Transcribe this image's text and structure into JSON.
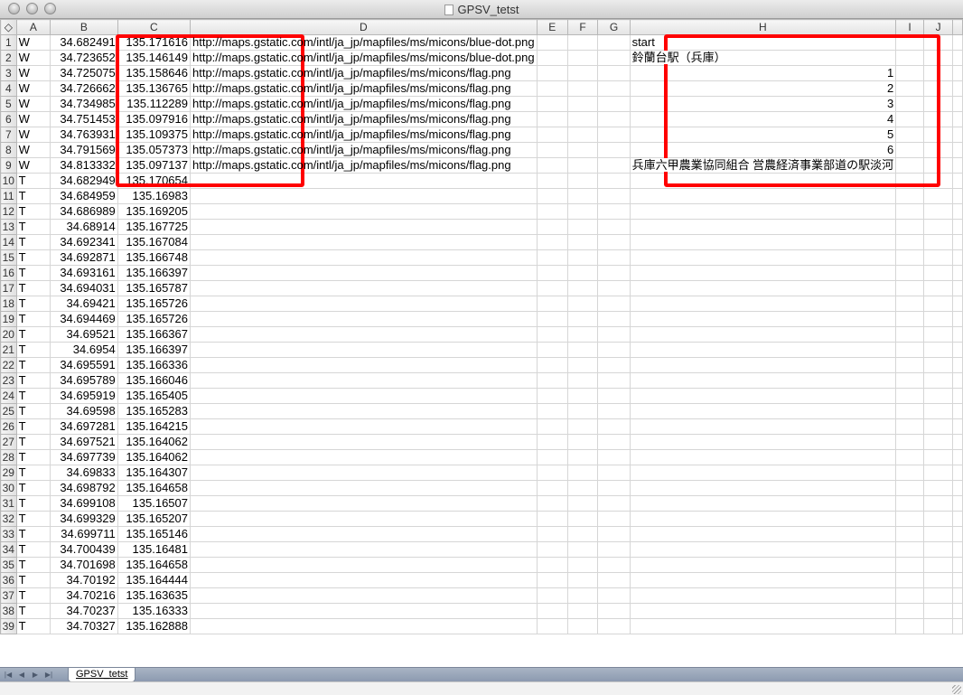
{
  "window": {
    "title": "GPSV_tetst"
  },
  "columns": [
    "A",
    "B",
    "C",
    "D",
    "E",
    "F",
    "G",
    "H",
    "I",
    "J"
  ],
  "corner_icon": "select-all-icon",
  "rows": [
    {
      "n": "1",
      "a": "W",
      "b": "34.682491",
      "c": "135.171616",
      "d": "http://maps.gstatic.com/intl/ja_jp/mapfiles/ms/micons/blue-dot.png",
      "h": "start"
    },
    {
      "n": "2",
      "a": "W",
      "b": "34.723652",
      "c": "135.146149",
      "d": "http://maps.gstatic.com/intl/ja_jp/mapfiles/ms/micons/blue-dot.png",
      "h": "鈴蘭台駅（兵庫）"
    },
    {
      "n": "3",
      "a": "W",
      "b": "34.725075",
      "c": "135.158646",
      "d": "http://maps.gstatic.com/intl/ja_jp/mapfiles/ms/micons/flag.png",
      "h": "1"
    },
    {
      "n": "4",
      "a": "W",
      "b": "34.726662",
      "c": "135.136765",
      "d": "http://maps.gstatic.com/intl/ja_jp/mapfiles/ms/micons/flag.png",
      "h": "2"
    },
    {
      "n": "5",
      "a": "W",
      "b": "34.734985",
      "c": "135.112289",
      "d": "http://maps.gstatic.com/intl/ja_jp/mapfiles/ms/micons/flag.png",
      "h": "3"
    },
    {
      "n": "6",
      "a": "W",
      "b": "34.751453",
      "c": "135.097916",
      "d": "http://maps.gstatic.com/intl/ja_jp/mapfiles/ms/micons/flag.png",
      "h": "4"
    },
    {
      "n": "7",
      "a": "W",
      "b": "34.763931",
      "c": "135.109375",
      "d": "http://maps.gstatic.com/intl/ja_jp/mapfiles/ms/micons/flag.png",
      "h": "5"
    },
    {
      "n": "8",
      "a": "W",
      "b": "34.791569",
      "c": "135.057373",
      "d": "http://maps.gstatic.com/intl/ja_jp/mapfiles/ms/micons/flag.png",
      "h": "6"
    },
    {
      "n": "9",
      "a": "W",
      "b": "34.813332",
      "c": "135.097137",
      "d": "http://maps.gstatic.com/intl/ja_jp/mapfiles/ms/micons/flag.png",
      "h": "兵庫六甲農業協同組合 営農経済事業部道の駅淡河"
    },
    {
      "n": "10",
      "a": "T",
      "b": "34.682949",
      "c": "135.170654"
    },
    {
      "n": "11",
      "a": "T",
      "b": "34.684959",
      "c": "135.16983"
    },
    {
      "n": "12",
      "a": "T",
      "b": "34.686989",
      "c": "135.169205"
    },
    {
      "n": "13",
      "a": "T",
      "b": "34.68914",
      "c": "135.167725"
    },
    {
      "n": "14",
      "a": "T",
      "b": "34.692341",
      "c": "135.167084"
    },
    {
      "n": "15",
      "a": "T",
      "b": "34.692871",
      "c": "135.166748"
    },
    {
      "n": "16",
      "a": "T",
      "b": "34.693161",
      "c": "135.166397"
    },
    {
      "n": "17",
      "a": "T",
      "b": "34.694031",
      "c": "135.165787"
    },
    {
      "n": "18",
      "a": "T",
      "b": "34.69421",
      "c": "135.165726"
    },
    {
      "n": "19",
      "a": "T",
      "b": "34.694469",
      "c": "135.165726"
    },
    {
      "n": "20",
      "a": "T",
      "b": "34.69521",
      "c": "135.166367"
    },
    {
      "n": "21",
      "a": "T",
      "b": "34.6954",
      "c": "135.166397"
    },
    {
      "n": "22",
      "a": "T",
      "b": "34.695591",
      "c": "135.166336"
    },
    {
      "n": "23",
      "a": "T",
      "b": "34.695789",
      "c": "135.166046"
    },
    {
      "n": "24",
      "a": "T",
      "b": "34.695919",
      "c": "135.165405"
    },
    {
      "n": "25",
      "a": "T",
      "b": "34.69598",
      "c": "135.165283"
    },
    {
      "n": "26",
      "a": "T",
      "b": "34.697281",
      "c": "135.164215"
    },
    {
      "n": "27",
      "a": "T",
      "b": "34.697521",
      "c": "135.164062"
    },
    {
      "n": "28",
      "a": "T",
      "b": "34.697739",
      "c": "135.164062"
    },
    {
      "n": "29",
      "a": "T",
      "b": "34.69833",
      "c": "135.164307"
    },
    {
      "n": "30",
      "a": "T",
      "b": "34.698792",
      "c": "135.164658"
    },
    {
      "n": "31",
      "a": "T",
      "b": "34.699108",
      "c": "135.16507"
    },
    {
      "n": "32",
      "a": "T",
      "b": "34.699329",
      "c": "135.165207"
    },
    {
      "n": "33",
      "a": "T",
      "b": "34.699711",
      "c": "135.165146"
    },
    {
      "n": "34",
      "a": "T",
      "b": "34.700439",
      "c": "135.16481"
    },
    {
      "n": "35",
      "a": "T",
      "b": "34.701698",
      "c": "135.164658"
    },
    {
      "n": "36",
      "a": "T",
      "b": "34.70192",
      "c": "135.164444"
    },
    {
      "n": "37",
      "a": "T",
      "b": "34.70216",
      "c": "135.163635"
    },
    {
      "n": "38",
      "a": "T",
      "b": "34.70237",
      "c": "135.16333"
    },
    {
      "n": "39",
      "a": "T",
      "b": "34.70327",
      "c": "135.162888"
    }
  ],
  "sheet_tab": {
    "label": "GPSV_tetst"
  },
  "highlight_color": "#ff0000"
}
